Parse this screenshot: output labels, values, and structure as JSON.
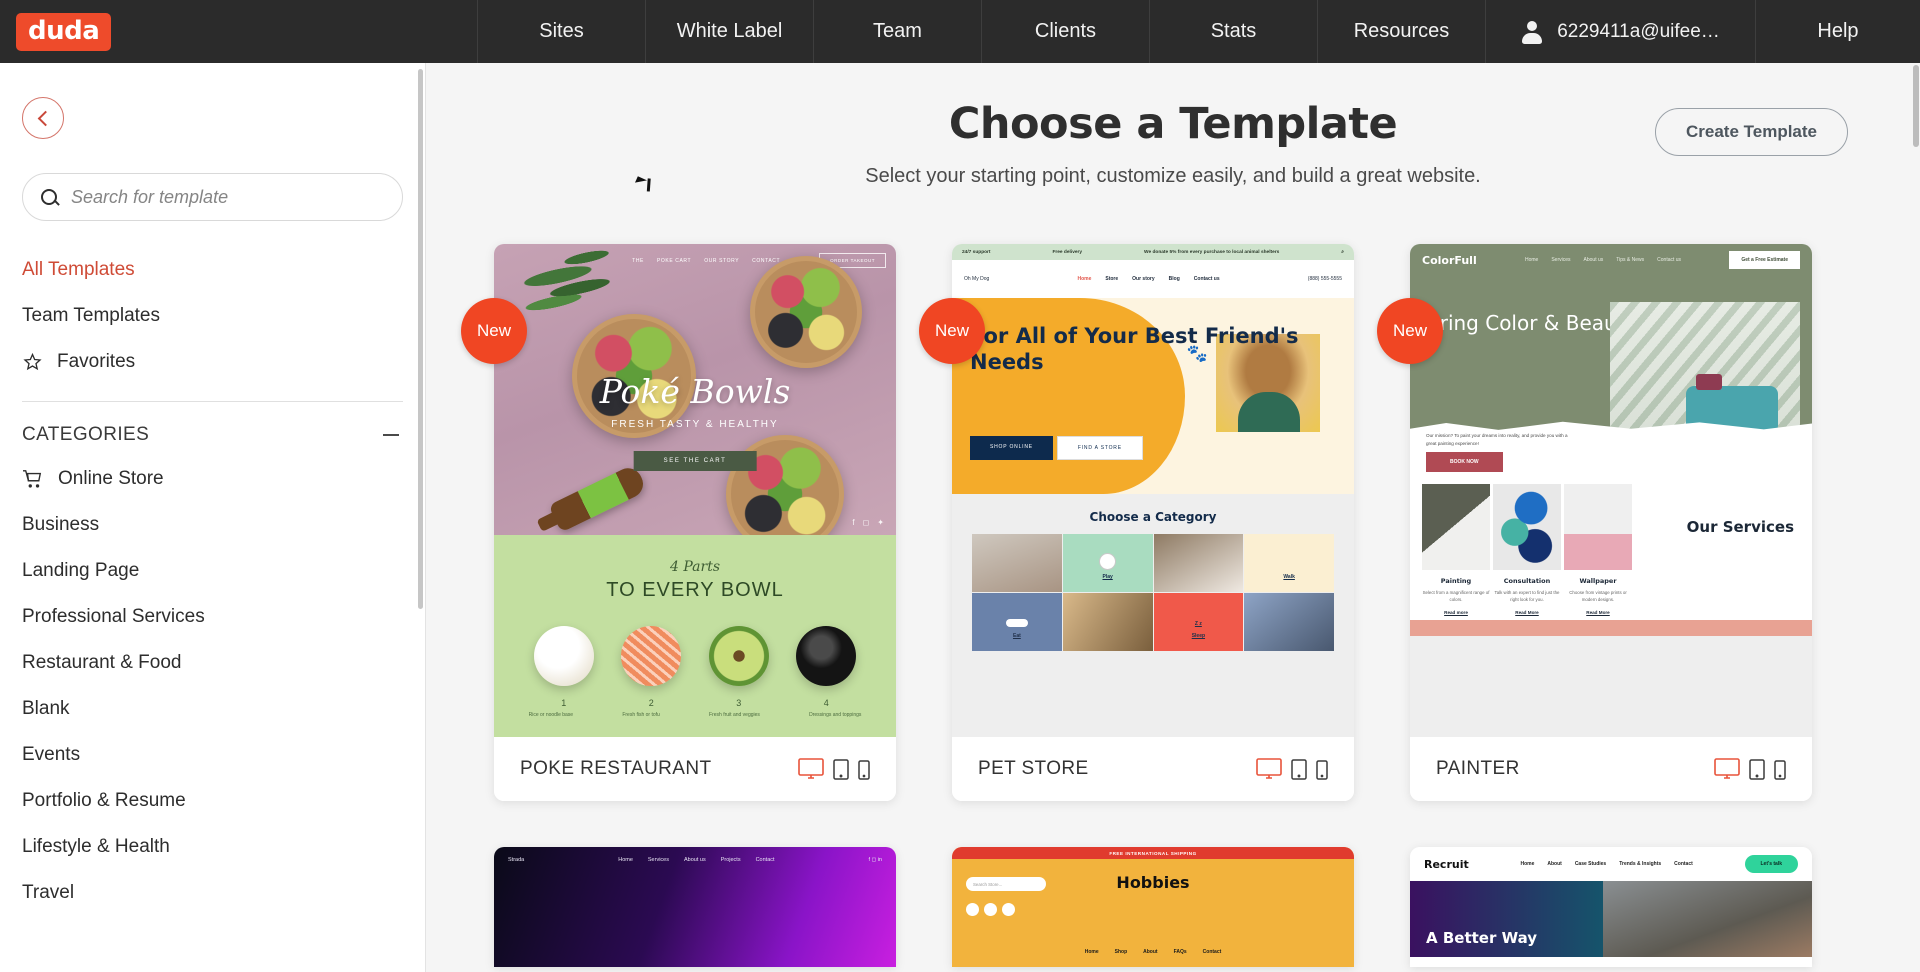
{
  "topbar": {
    "brand": "duda",
    "nav": [
      {
        "label": "Sites"
      },
      {
        "label": "White Label"
      },
      {
        "label": "Team"
      },
      {
        "label": "Clients"
      },
      {
        "label": "Stats"
      },
      {
        "label": "Resources"
      }
    ],
    "account": "6229411a@uifee…",
    "help": "Help"
  },
  "sidebar": {
    "search_placeholder": "Search for template",
    "links": [
      {
        "label": "All Templates",
        "active": true
      },
      {
        "label": "Team Templates",
        "active": false
      },
      {
        "label": "Favorites",
        "active": false
      }
    ],
    "categories_title": "CATEGORIES",
    "categories": [
      {
        "label": "Online Store"
      },
      {
        "label": "Business"
      },
      {
        "label": "Landing Page"
      },
      {
        "label": "Professional Services"
      },
      {
        "label": "Restaurant & Food"
      },
      {
        "label": "Blank"
      },
      {
        "label": "Events"
      },
      {
        "label": "Portfolio & Resume"
      },
      {
        "label": "Lifestyle & Health"
      },
      {
        "label": "Travel"
      }
    ]
  },
  "main": {
    "title": "Choose a Template",
    "subtitle": "Select your starting point, customize easily, and build a great website.",
    "create_button": "Create Template"
  },
  "templates": [
    {
      "name": "POKE RESTAURANT",
      "badge": "New",
      "devices": {
        "desktop": "desktop-icon",
        "tablet": "tablet-icon",
        "mobile": "mobile-icon",
        "active": "desktop"
      },
      "preview": {
        "hero_title": "Poké Bowls",
        "hero_sub": "FRESH TASTY & HEALTHY",
        "hero_cta": "SEE THE CART",
        "nav": [
          "THE",
          "POKE CART",
          "OUR STORY",
          "CONTACT"
        ],
        "nav_button": "ORDER TAKEOUT",
        "section_script": "4 Parts",
        "section_head": "TO EVERY BOWL",
        "steps": [
          "1",
          "2",
          "3",
          "4"
        ],
        "step_captions": [
          "Rice or noodle base",
          "Fresh fish or tofu",
          "Fresh fruit and veggies",
          "Dressings and toppings"
        ]
      }
    },
    {
      "name": "PET STORE",
      "badge": "New",
      "devices": {
        "desktop": "desktop-icon",
        "tablet": "tablet-icon",
        "mobile": "mobile-icon",
        "active": "desktop"
      },
      "preview": {
        "strip_left": "24/7 support",
        "strip_mid": "Free delivery",
        "strip_banner": "We donate 5% from every purchase to local animal shelters",
        "logo": "Oh My Dog",
        "nav": [
          "Home",
          "Store",
          "Our story",
          "Blog",
          "Contact us"
        ],
        "phone": "(888) 555-5555",
        "hero_title": "For All of Your Best Friend's Needs",
        "btn_primary": "SHOP ONLINE",
        "btn_secondary": "FIND A STORE",
        "category_head": "Choose a Category",
        "categories": [
          "Play",
          "Walk",
          "Eat",
          "Sleep"
        ]
      }
    },
    {
      "name": "PAINTER",
      "badge": "New",
      "devices": {
        "desktop": "desktop-icon",
        "tablet": "tablet-icon",
        "mobile": "mobile-icon",
        "active": "desktop"
      },
      "preview": {
        "logo": "ColorFull",
        "nav": [
          "Home",
          "Services",
          "About us",
          "Tips & News",
          "Contact us"
        ],
        "nav_cta": "Get a Free Estimate",
        "hero_title": "Bring Color & Beauty to Your Life",
        "mission": "Our mission? To paint your dreams into reality, and provide you with a great painting experience!",
        "book_btn": "BOOK NOW",
        "services_head": "Our Services",
        "services": [
          {
            "title": "Painting",
            "desc": "Select from a magnificent range of colors.",
            "link": "Read more"
          },
          {
            "title": "Consultation",
            "desc": "Talk with an expert to find just the right look for you.",
            "link": "Read More"
          },
          {
            "title": "Wallpaper",
            "desc": "Choose from vintage prints or modern designs.",
            "link": "Read More"
          }
        ]
      }
    }
  ],
  "templates_row2": [
    {
      "preview": {
        "logo": "Strada",
        "nav": [
          "Home",
          "Services",
          "About us",
          "Projects",
          "Contact"
        ]
      }
    },
    {
      "preview": {
        "banner": "FREE INTERNATIONAL SHIPPING",
        "logo": "Hobbies",
        "search_placeholder": "Search Store...",
        "nav": [
          "Home",
          "Shop",
          "About",
          "FAQs",
          "Contact"
        ]
      }
    },
    {
      "preview": {
        "logo": "Recruit",
        "nav": [
          "Home",
          "About",
          "Case Studies",
          "Trends & Insights",
          "Contact"
        ],
        "cta": "Let's talk",
        "hero_title": "A Better Way"
      }
    }
  ],
  "colors": {
    "brand_red": "#ee4b2b",
    "accent_red": "#cf4b36",
    "topbar_bg": "#2b2b2b",
    "main_bg": "#f5f5f5",
    "badge_new": "#f04623"
  }
}
